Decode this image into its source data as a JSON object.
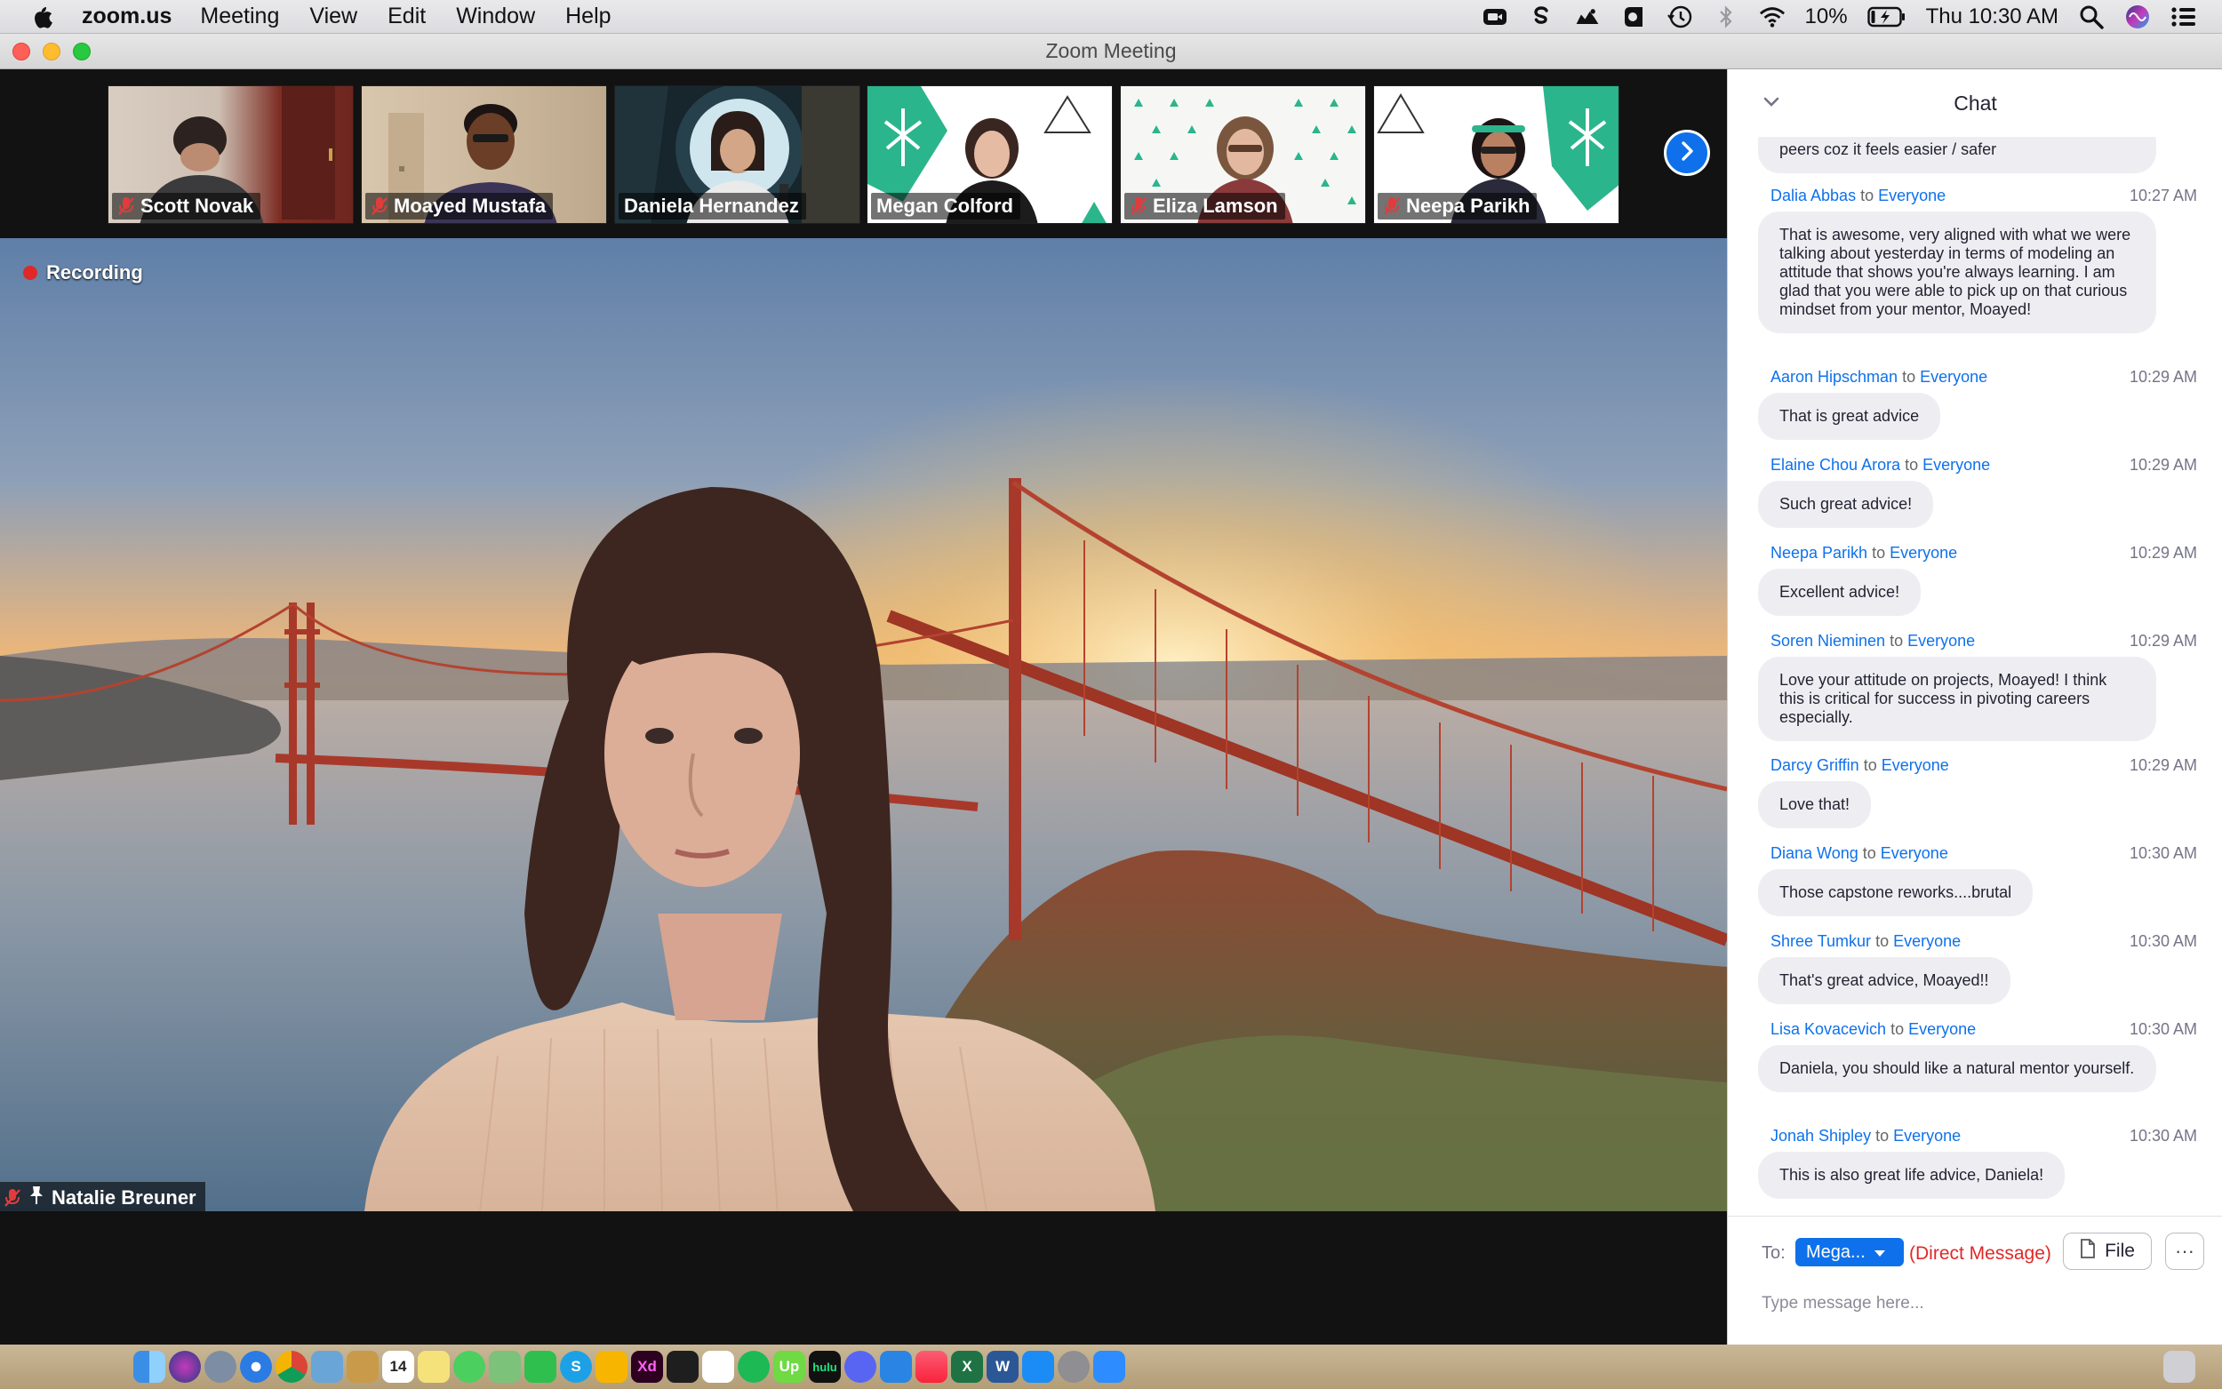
{
  "menubar": {
    "app_name": "zoom.us",
    "menus": [
      "Meeting",
      "View",
      "Edit",
      "Window",
      "Help"
    ],
    "battery": "10%",
    "clock": "Thu 10:30 AM",
    "status_icons": [
      "video-camera-icon",
      "skype-icon",
      "cloud-icon",
      "creative-cloud-icon",
      "time-machine-icon",
      "bluetooth-icon",
      "wifi-icon",
      "battery-charging-icon",
      "search-icon",
      "siri-icon",
      "control-center-icon"
    ]
  },
  "window": {
    "title": "Zoom Meeting"
  },
  "gallery": {
    "participants": [
      {
        "name": "Scott Novak",
        "muted": true
      },
      {
        "name": "Moayed Mustafa",
        "muted": true
      },
      {
        "name": "Daniela Hernandez",
        "muted": false
      },
      {
        "name": "Megan Colford",
        "muted": false
      },
      {
        "name": "Eliza Lamson",
        "muted": true
      },
      {
        "name": "Neepa Parikh",
        "muted": true
      }
    ]
  },
  "main_video": {
    "recording_label": "Recording",
    "speaker_name": "Natalie Breuner"
  },
  "chat": {
    "title": "Chat",
    "partial_message": "peers coz it feels easier / safer",
    "to_word": "to",
    "messages": [
      {
        "sender": "Dalia Abbas",
        "recipient": "Everyone",
        "time": "10:27 AM",
        "text": "That is awesome, very aligned with what we were talking about yesterday in terms of modeling an attitude that shows you're always learning. I am glad that you were able to pick up on that curious mindset from your mentor, Moayed!"
      },
      {
        "sender": "Aaron Hipschman",
        "recipient": "Everyone",
        "time": "10:29 AM",
        "text": "That is great advice"
      },
      {
        "sender": "Elaine Chou Arora",
        "recipient": "Everyone",
        "time": "10:29 AM",
        "text": "Such great advice!"
      },
      {
        "sender": "Neepa Parikh",
        "recipient": "Everyone",
        "time": "10:29 AM",
        "text": "Excellent advice!"
      },
      {
        "sender": "Soren Nieminen",
        "recipient": "Everyone",
        "time": "10:29 AM",
        "text": "Love your attitude on projects, Moayed! I think this is critical for success in pivoting careers especially."
      },
      {
        "sender": "Darcy Griffin",
        "recipient": "Everyone",
        "time": "10:29 AM",
        "text": "Love that!"
      },
      {
        "sender": "Diana Wong",
        "recipient": "Everyone",
        "time": "10:30 AM",
        "text": "Those capstone reworks....brutal"
      },
      {
        "sender": "Shree Tumkur",
        "recipient": "Everyone",
        "time": "10:30 AM",
        "text": "That's great advice, Moayed!!"
      },
      {
        "sender": "Lisa Kovacevich",
        "recipient": "Everyone",
        "time": "10:30 AM",
        "text": "Daniela, you should like a natural mentor yourself."
      },
      {
        "sender": "Jonah Shipley",
        "recipient": "Everyone",
        "time": "10:30 AM",
        "text": "This is also great life advice, Daniela!"
      }
    ],
    "footer": {
      "to_label": "To:",
      "recipient": "Mega...",
      "direct_label": "(Direct Message)",
      "file_label": "File",
      "more_label": "···",
      "input_placeholder": "Type message here..."
    }
  },
  "colors": {
    "zoom_blue": "#0e71eb",
    "recording_red": "#e02828",
    "bubble_bg": "#eeeef2"
  },
  "dock": {
    "icons": [
      "finder-icon",
      "siri-icon",
      "launchpad-icon",
      "safari-icon",
      "chrome-icon",
      "preview-icon",
      "notes-icon",
      "calendar-icon",
      "stickies-icon",
      "messages-icon",
      "maps-icon",
      "facetime-icon",
      "skype-icon",
      "sketch-icon",
      "xd-icon",
      "figma-icon",
      "slack-icon",
      "spotify-icon",
      "upwork-icon",
      "hulu-icon",
      "discord-icon",
      "keynote-icon",
      "music-icon",
      "excel-icon",
      "word-icon",
      "app-store-icon",
      "system-preferences-icon",
      "zoom-icon",
      "trash-icon"
    ],
    "calendar_day": "14",
    "xd_label": "Xd",
    "hulu_label": "hulu",
    "up_label": "Up"
  }
}
